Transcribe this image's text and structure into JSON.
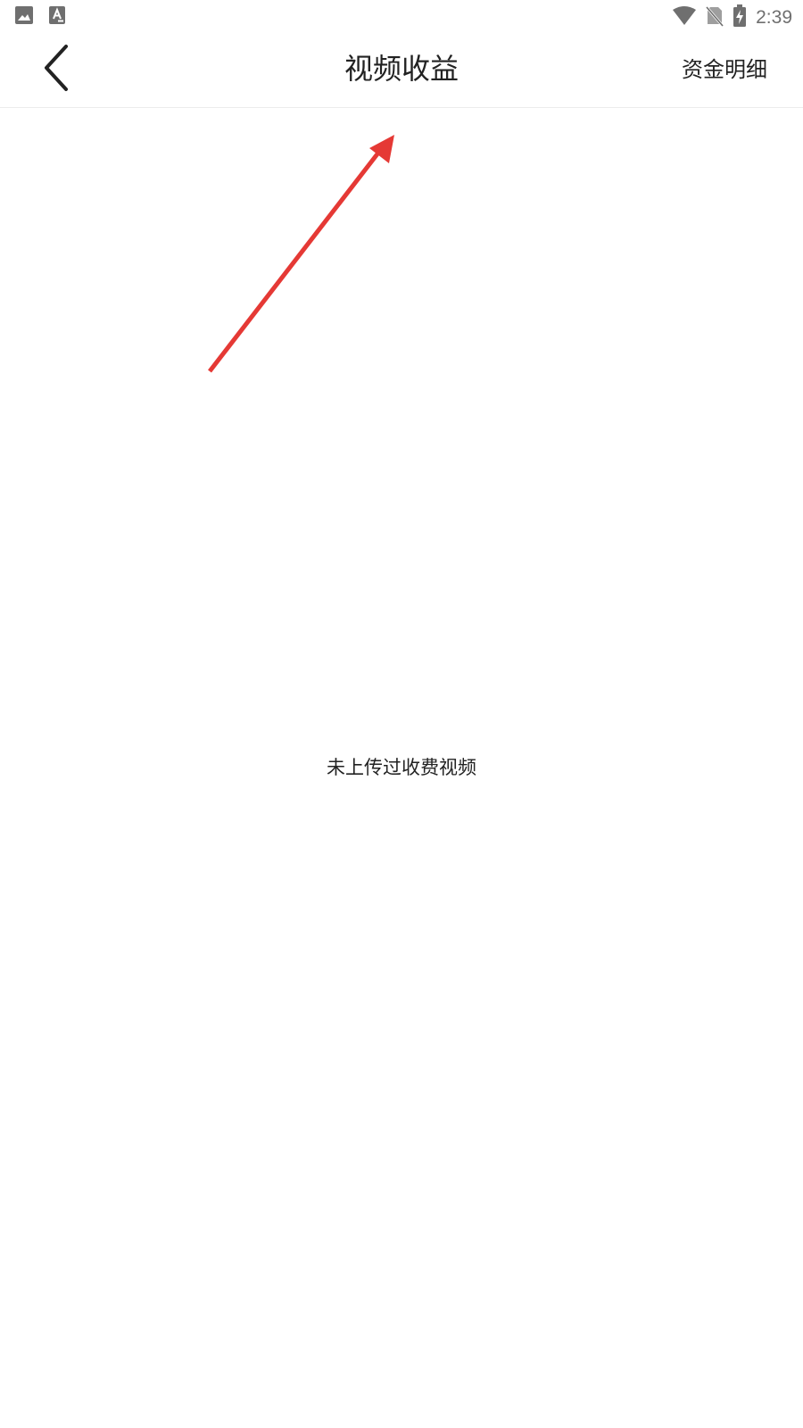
{
  "status_bar": {
    "left_icons": [
      "image-notification-icon",
      "text-notification-icon"
    ],
    "right_icons": [
      "wifi-icon",
      "no-sim-icon",
      "battery-charging-icon"
    ],
    "time": "2:39"
  },
  "app_bar": {
    "title": "视频收益",
    "right_action_label": "资金明细",
    "back_icon": "chevron-left-icon"
  },
  "content": {
    "empty_message": "未上传过收费视频"
  },
  "annotation": {
    "arrow_color": "#e53935"
  }
}
